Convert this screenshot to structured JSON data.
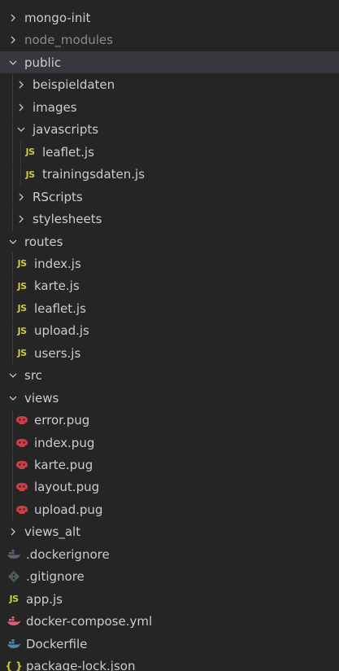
{
  "explorer": {
    "items": [
      {
        "name": "mongo-init",
        "kind": "folder",
        "depth": 0,
        "open": false,
        "icon": "chevron-right-icon"
      },
      {
        "name": "node_modules",
        "kind": "folder",
        "depth": 0,
        "open": false,
        "dim": true,
        "icon": "chevron-right-icon"
      },
      {
        "name": "public",
        "kind": "folder",
        "depth": 0,
        "open": true,
        "active": true,
        "icon": "chevron-down-icon"
      },
      {
        "name": "beispieldaten",
        "kind": "folder",
        "depth": 1,
        "open": false,
        "icon": "chevron-right-icon"
      },
      {
        "name": "images",
        "kind": "folder",
        "depth": 1,
        "open": false,
        "icon": "chevron-right-icon"
      },
      {
        "name": "javascripts",
        "kind": "folder",
        "depth": 1,
        "open": true,
        "icon": "chevron-down-icon"
      },
      {
        "name": "leaflet.js",
        "kind": "js",
        "depth": 2,
        "icon": "js-file-icon"
      },
      {
        "name": "trainingsdaten.js",
        "kind": "js",
        "depth": 2,
        "icon": "js-file-icon"
      },
      {
        "name": "RScripts",
        "kind": "folder",
        "depth": 1,
        "open": false,
        "icon": "chevron-right-icon"
      },
      {
        "name": "stylesheets",
        "kind": "folder",
        "depth": 1,
        "open": false,
        "icon": "chevron-right-icon"
      },
      {
        "name": "routes",
        "kind": "folder",
        "depth": 0,
        "open": true,
        "icon": "chevron-down-icon"
      },
      {
        "name": "index.js",
        "kind": "js",
        "depth": 1,
        "icon": "js-file-icon"
      },
      {
        "name": "karte.js",
        "kind": "js",
        "depth": 1,
        "icon": "js-file-icon"
      },
      {
        "name": "leaflet.js",
        "kind": "js",
        "depth": 1,
        "icon": "js-file-icon"
      },
      {
        "name": "upload.js",
        "kind": "js",
        "depth": 1,
        "icon": "js-file-icon"
      },
      {
        "name": "users.js",
        "kind": "js",
        "depth": 1,
        "icon": "js-file-icon"
      },
      {
        "name": "src",
        "kind": "folder",
        "depth": 0,
        "open": true,
        "icon": "chevron-down-icon"
      },
      {
        "name": "views",
        "kind": "folder",
        "depth": 0,
        "open": true,
        "icon": "chevron-down-icon"
      },
      {
        "name": "error.pug",
        "kind": "pug",
        "depth": 1,
        "icon": "pug-file-icon"
      },
      {
        "name": "index.pug",
        "kind": "pug",
        "depth": 1,
        "icon": "pug-file-icon"
      },
      {
        "name": "karte.pug",
        "kind": "pug",
        "depth": 1,
        "icon": "pug-file-icon"
      },
      {
        "name": "layout.pug",
        "kind": "pug",
        "depth": 1,
        "icon": "pug-file-icon"
      },
      {
        "name": "upload.pug",
        "kind": "pug",
        "depth": 1,
        "icon": "pug-file-icon"
      },
      {
        "name": "views_alt",
        "kind": "folder",
        "depth": 0,
        "open": false,
        "icon": "chevron-right-icon"
      },
      {
        "name": ".dockerignore",
        "kind": "dockerignore",
        "depth": 0,
        "icon": "docker-ignore-icon"
      },
      {
        "name": ".gitignore",
        "kind": "git",
        "depth": 0,
        "icon": "git-icon"
      },
      {
        "name": "app.js",
        "kind": "js",
        "depth": 0,
        "icon": "js-file-icon"
      },
      {
        "name": "docker-compose.yml",
        "kind": "compose",
        "depth": 0,
        "icon": "docker-compose-icon"
      },
      {
        "name": "Dockerfile",
        "kind": "docker",
        "depth": 0,
        "icon": "docker-icon"
      },
      {
        "name": "package-lock.json",
        "kind": "json",
        "depth": 0,
        "icon": "json-file-icon"
      }
    ],
    "icon_glyphs": {
      "js": "JS",
      "json": "{ }"
    },
    "colors": {
      "background": "#252526",
      "active_row": "#37373d",
      "text": "#cccccc",
      "dim_text": "#8b8b8b",
      "js_icon": "#cbcb41",
      "pug_icon": "#cc3e44",
      "docker_icon": "#498ba7",
      "dockerignore_icon": "#5a6470",
      "git_icon": "#4d5a5e",
      "compose_icon": "#e05e7a"
    }
  }
}
